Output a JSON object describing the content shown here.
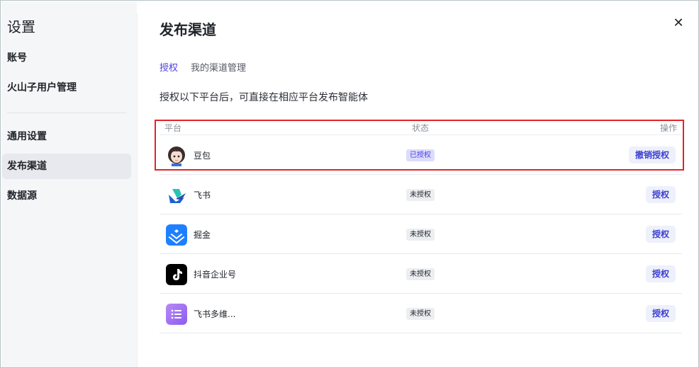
{
  "sidebar": {
    "title": "设置",
    "items": [
      {
        "label": "账号"
      },
      {
        "label": "火山子用户管理"
      },
      {
        "label": "通用设置"
      },
      {
        "label": "发布渠道",
        "active": true
      },
      {
        "label": "数据源"
      }
    ]
  },
  "main": {
    "title": "发布渠道",
    "tabs": [
      {
        "label": "授权",
        "active": true
      },
      {
        "label": "我的渠道管理"
      }
    ],
    "description": "授权以下平台后，可直接在相应平台发布智能体",
    "table": {
      "headers": {
        "platform": "平台",
        "status": "状态",
        "action": "操作"
      },
      "rows": [
        {
          "name": "豆包",
          "status": "已授权",
          "action": "撤销授权",
          "icon": "doubao-avatar-icon"
        },
        {
          "name": "飞书",
          "status": "未授权",
          "action": "授权",
          "icon": "feishu-icon"
        },
        {
          "name": "掘金",
          "status": "未授权",
          "action": "授权",
          "icon": "juejin-icon"
        },
        {
          "name": "抖音企业号",
          "status": "未授权",
          "action": "授权",
          "icon": "douyin-icon"
        },
        {
          "name": "飞书多维...",
          "status": "未授权",
          "action": "授权",
          "icon": "feishu-bitable-icon"
        }
      ]
    }
  },
  "colors": {
    "accent": "#4e40e5",
    "highlight_border": "#e2242a"
  }
}
